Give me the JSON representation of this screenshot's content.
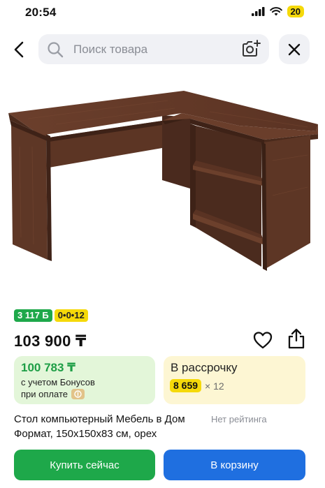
{
  "status_bar": {
    "time": "20:54",
    "battery": "20",
    "icons": [
      "signal-icon",
      "wifi-icon",
      "battery-icon"
    ]
  },
  "header": {
    "back_icon": "chevron-left-icon",
    "search_placeholder": "Поиск товара",
    "search_icon": "search-icon",
    "camera_icon": "camera-icon",
    "close_icon": "close-icon"
  },
  "product": {
    "image": "l-shaped-computer-desk-walnut",
    "badge_bonus": "3 117 Б",
    "badge_installment": "0•0•12",
    "price": "103 900 ₸",
    "title_line1": "Стол компьютерный Мебель в Дом",
    "title_line2": "Формат, 150х150х83 см, орех",
    "rating": "Нет рейтинга"
  },
  "bonus_card": {
    "price": "100 783 ₸",
    "line1": "с учетом Бонусов",
    "line2": "при оплате"
  },
  "installment_card": {
    "title": "В рассрочку",
    "amount": "8 659",
    "times": "× 12"
  },
  "actions": {
    "buy_now": "Купить сейчас",
    "add_to_cart": "В корзину"
  },
  "colors": {
    "green": "#1ea84a",
    "blue": "#1f6fe0",
    "yellow": "#f5d90a",
    "wood": "#5a3424"
  }
}
